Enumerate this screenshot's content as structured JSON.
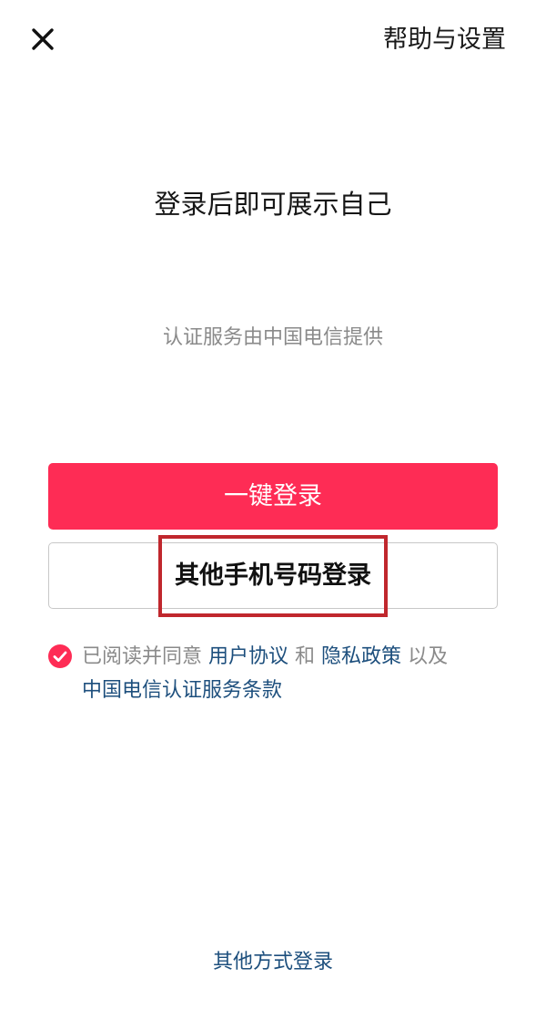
{
  "header": {
    "close_icon": "close-icon",
    "help_settings_label": "帮助与设置"
  },
  "main": {
    "headline": "登录后即可展示自己",
    "provider_text": "认证服务由中国电信提供",
    "one_click_login_label": "一键登录",
    "other_phone_login_label": "其他手机号码登录"
  },
  "agreement": {
    "checked": true,
    "checkbox_icon": "check-circle-icon",
    "prefix": "已阅读并同意",
    "user_agreement_link": "用户协议",
    "and_text": "和",
    "privacy_policy_link": "隐私政策",
    "also_text": "以及",
    "telecom_terms_link": "中国电信认证服务条款"
  },
  "footer": {
    "other_methods_label": "其他方式登录"
  },
  "colors": {
    "primary": "#fe2c55",
    "link": "#1d4f7d",
    "annotation_box": "#c0272d"
  }
}
